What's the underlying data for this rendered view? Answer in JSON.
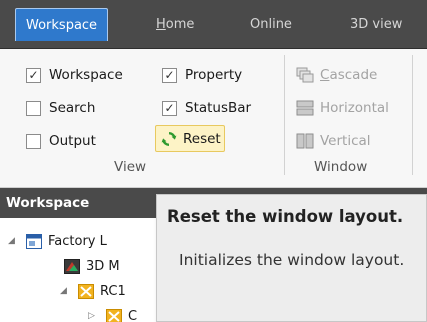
{
  "tabs": {
    "workspace": "Workspace",
    "home_first": "H",
    "home_rest": "ome",
    "online": "Online",
    "view3d": "3D view"
  },
  "view_group": {
    "workspace": "Workspace",
    "property": "Property",
    "search": "Search",
    "statusbar": "StatusBar",
    "output": "Output",
    "reset": "Reset",
    "label": "View",
    "workspace_checked": true,
    "property_checked": true,
    "search_checked": false,
    "statusbar_checked": true,
    "output_checked": false
  },
  "window_group": {
    "cascade_first": "C",
    "cascade_rest": "ascade",
    "horizontal": "Horizontal",
    "vertical": "Vertical",
    "label": "Window"
  },
  "panel": {
    "title": "Workspace"
  },
  "tree": {
    "factory": "Factory L",
    "model3d": "3D M",
    "rc1": "RC1",
    "child": "C"
  },
  "tooltip": {
    "title": "Reset the window layout.",
    "description": "Initializes the window layout."
  },
  "colors": {
    "accent_tab": "#2f79cc",
    "ribbon_dark": "#4a4a4a",
    "reset_highlight": "#fdf3c6"
  }
}
